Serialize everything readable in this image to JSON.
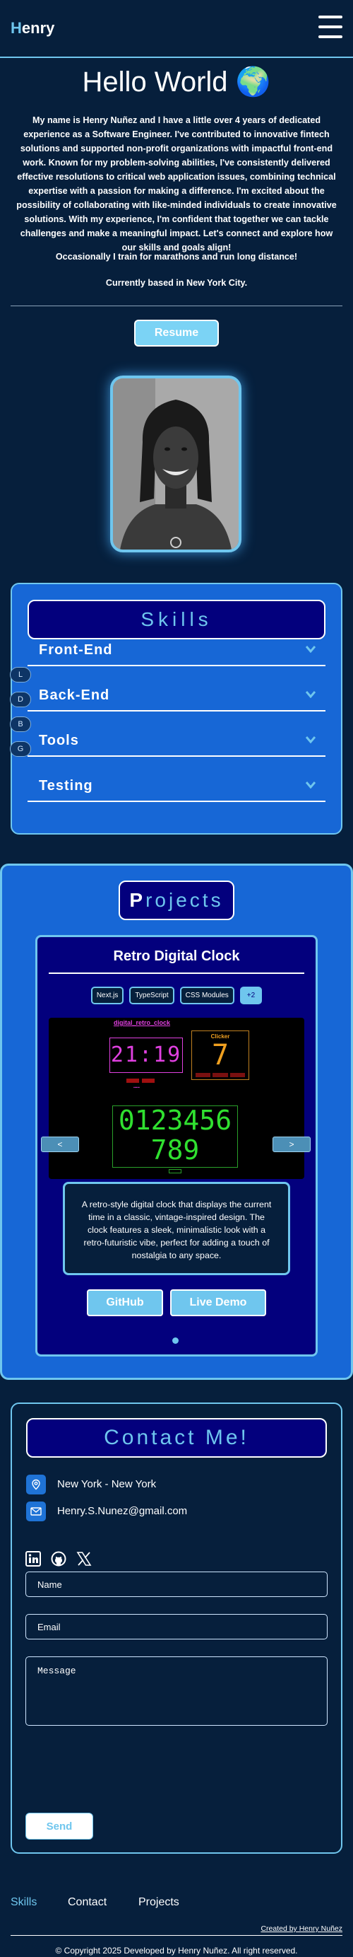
{
  "header": {
    "logo_first": "H",
    "logo_rest": "enry"
  },
  "hero": {
    "title": "Hello World 🌍",
    "bio": "My name is Henry Nuñez and I have a little over 4 years of dedicated experience as a Software Engineer. I've contributed to innovative fintech solutions and supported non-profit organizations with impactful front-end work. Known for my problem-solving abilities, I've consistently delivered effective resolutions to critical web application issues, combining technical expertise with a passion for making a difference. I'm excited about the possibility of collaborating with like-minded individuals to create innovative solutions. With my experience, I'm confident that together we can tackle challenges and make a meaningful impact. Let's connect and explore how our skills and goals align!",
    "hobby": "Occasionally I train for marathons and run long distance!",
    "location": "Currently based in New York City.",
    "resume_label": "Resume"
  },
  "skills": {
    "title": "Skills",
    "items": [
      {
        "label": "Front-End",
        "tab": "L"
      },
      {
        "label": "Back-End",
        "tab": "D"
      },
      {
        "label": "Tools",
        "tab": "B"
      },
      {
        "label": "Testing",
        "tab": "G"
      }
    ]
  },
  "projects": {
    "title_first": "P",
    "title_rest": "rojects",
    "current": {
      "title": "Retro Digital Clock",
      "tags": [
        "Next.js",
        "TypeScript",
        "CSS Modules",
        "+2"
      ],
      "description": "A retro-style digital clock that displays the current time in a classic, vintage-inspired design. The clock features a sleek, minimalistic look with a retro-futuristic vibe, perfect for adding a touch of nostalgia to any space.",
      "github_label": "GitHub",
      "demo_label": "Live Demo",
      "prev_label": "<",
      "next_label": ">",
      "preview": {
        "clock_title": "digital_retro_clock",
        "clock_time": "21:19",
        "clicker_title": "Clicker",
        "clicker_value": "7",
        "digits_line1": "0123456",
        "digits_line2": "789"
      }
    }
  },
  "contact": {
    "title": "Contact Me!",
    "location": "New York - New York",
    "email": "Henry.S.Nunez@gmail.com",
    "name_placeholder": "Name",
    "email_placeholder": "Email",
    "message_placeholder": "Message",
    "send_label": "Send"
  },
  "footer": {
    "links": [
      "Skills",
      "Contact",
      "Projects"
    ],
    "credit": "Created by Henry Nuñez",
    "copyright": "© Copyright 2025 Developed by Henry Nuñez. All right reserved."
  },
  "colors": {
    "background": "#061f3c",
    "accent": "#6fc6ee",
    "card_blue": "#1767d6",
    "navy": "#03007d"
  }
}
